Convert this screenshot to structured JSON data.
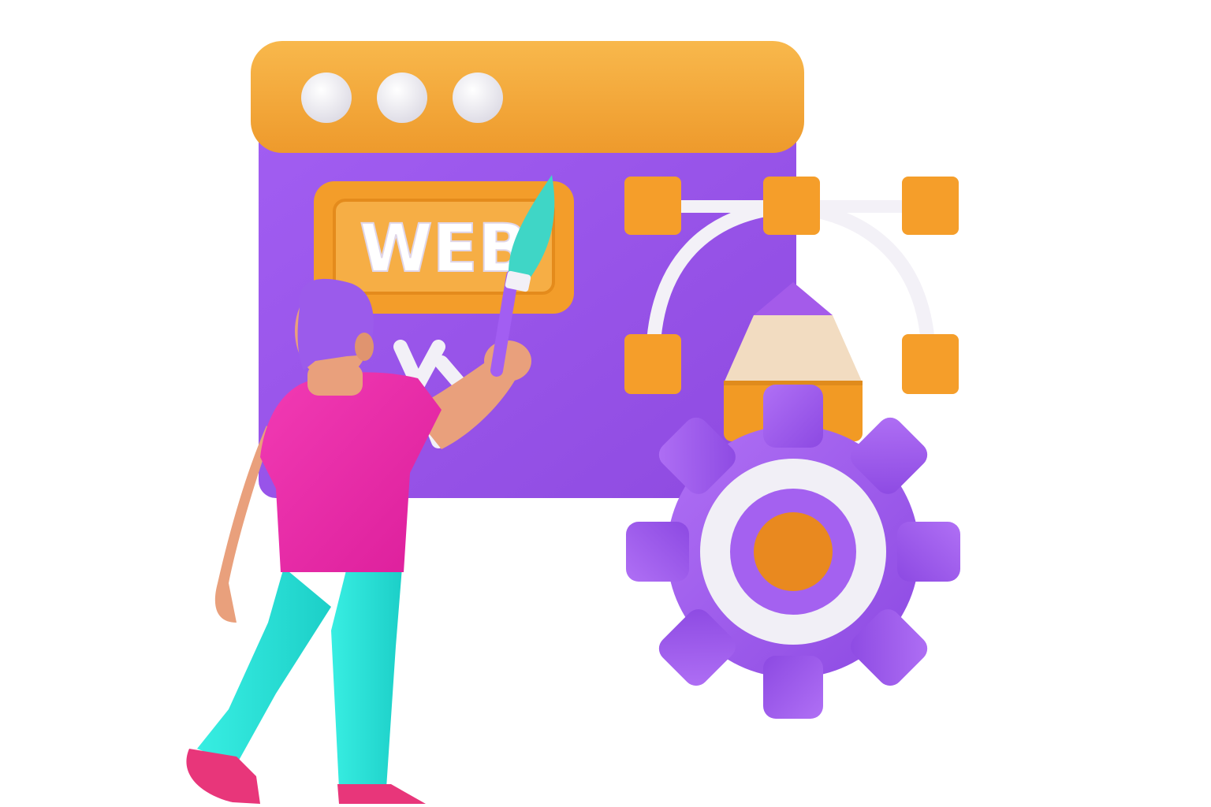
{
  "illustration": {
    "badge_text": "WEB",
    "icons": [
      "browser-window-icon",
      "window-dots-icon",
      "web-badge-icon",
      "bezier-curve-icon",
      "pencil-icon",
      "gear-icon",
      "paint-brush-icon",
      "person-figure"
    ],
    "colors": {
      "window_bar": "#F5A83A",
      "window_body": "#9B55E8",
      "bezier_nodes": "#F59E2A",
      "pencil_body": "#F29A24",
      "pencil_wood": "#F2DCC1",
      "pencil_tip": "#A45BEA",
      "gear": "#A461F0",
      "gear_ring": "#F1EFF6",
      "gear_center": "#E9891F",
      "shirt": "#EE2AA9",
      "pants": "#2DE6DC",
      "hair": "#9B5BEB",
      "skin": "#E9A07C",
      "brush_tip": "#3FD6C6",
      "shoes": "#E8367A"
    }
  }
}
